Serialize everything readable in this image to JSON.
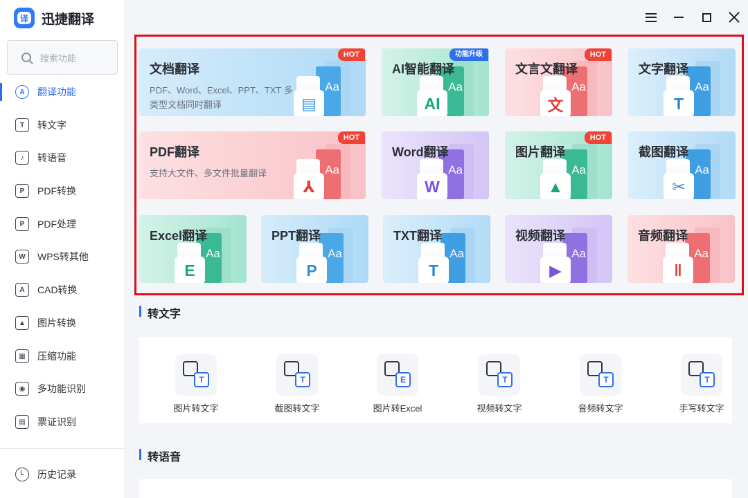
{
  "app": {
    "title": "迅捷翻译",
    "logo_glyph": "译"
  },
  "search": {
    "placeholder": "搜索功能"
  },
  "sidebar": {
    "items": [
      {
        "label": "翻译功能",
        "icon": "translate-icon",
        "glyph": "A"
      },
      {
        "label": "转文字",
        "icon": "text-convert-icon",
        "glyph": "T"
      },
      {
        "label": "转语音",
        "icon": "voice-icon",
        "glyph": "♪"
      },
      {
        "label": "PDF转换",
        "icon": "pdf-convert-icon",
        "glyph": "P"
      },
      {
        "label": "PDF处理",
        "icon": "pdf-process-icon",
        "glyph": "P"
      },
      {
        "label": "WPS转其他",
        "icon": "wps-icon",
        "glyph": "W"
      },
      {
        "label": "CAD转换",
        "icon": "cad-icon",
        "glyph": "A"
      },
      {
        "label": "图片转换",
        "icon": "image-convert-icon",
        "glyph": "▲"
      },
      {
        "label": "压缩功能",
        "icon": "compress-icon",
        "glyph": "▦"
      },
      {
        "label": "多功能识别",
        "icon": "eye-icon",
        "glyph": "◉"
      },
      {
        "label": "票证识别",
        "icon": "ticket-icon",
        "glyph": "▤"
      },
      {
        "label": "历史记录",
        "icon": "history-icon"
      }
    ]
  },
  "translate_cards": [
    {
      "title": "文档翻译",
      "desc": "PDF、Word、Excel、PPT、TXT 多类型文档同时翻译",
      "badge": "HOT",
      "theme": "c-blue",
      "glyph": "▤",
      "aa": "Aa"
    },
    {
      "title": "AI智能翻译",
      "desc": "",
      "badge": "功能升级",
      "theme": "c-green",
      "glyph": "AI",
      "aa": "Aa"
    },
    {
      "title": "文言文翻译",
      "desc": "",
      "badge": "HOT",
      "theme": "c-red",
      "glyph": "文",
      "aa": "Aa"
    },
    {
      "title": "文字翻译",
      "desc": "",
      "badge": "",
      "theme": "c-blue2",
      "glyph": "T",
      "aa": "Aa"
    },
    {
      "title": "PDF翻译",
      "desc": "支持大文件、多文件批量翻译",
      "badge": "HOT",
      "theme": "c-red",
      "glyph": "⅄",
      "aa": "Aa"
    },
    {
      "title": "Word翻译",
      "desc": "",
      "badge": "",
      "theme": "c-purple",
      "glyph": "W",
      "aa": "Aa"
    },
    {
      "title": "图片翻译",
      "desc": "",
      "badge": "HOT",
      "theme": "c-green",
      "glyph": "▲",
      "aa": "Aa"
    },
    {
      "title": "截图翻译",
      "desc": "",
      "badge": "",
      "theme": "c-blue2",
      "glyph": "✂",
      "aa": "Aa"
    },
    {
      "title": "Excel翻译",
      "desc": "",
      "badge": "",
      "theme": "c-green",
      "glyph": "E",
      "aa": "Aa"
    },
    {
      "title": "PPT翻译",
      "desc": "",
      "badge": "",
      "theme": "c-blue",
      "glyph": "P",
      "aa": "Aa"
    },
    {
      "title": "TXT翻译",
      "desc": "",
      "badge": "",
      "theme": "c-blue2",
      "glyph": "T",
      "aa": "Aa"
    },
    {
      "title": "视频翻译",
      "desc": "",
      "badge": "",
      "theme": "c-purple",
      "glyph": "▶",
      "aa": "Aa"
    },
    {
      "title": "音频翻译",
      "desc": "",
      "badge": "",
      "theme": "c-red",
      "glyph": "‖",
      "aa": "Aa"
    }
  ],
  "sections": {
    "to_text": {
      "title": "转文字",
      "tools": [
        {
          "label": "图片转文字",
          "icon": "image-to-text-icon",
          "glyph": "T"
        },
        {
          "label": "截图转文字",
          "icon": "screenshot-to-text-icon",
          "glyph": "T"
        },
        {
          "label": "图片转Excel",
          "icon": "image-to-excel-icon",
          "glyph": "E"
        },
        {
          "label": "视频转文字",
          "icon": "video-to-text-icon",
          "glyph": "T"
        },
        {
          "label": "音频转文字",
          "icon": "audio-to-text-icon",
          "glyph": "T"
        },
        {
          "label": "手写转文字",
          "icon": "handwriting-to-text-icon",
          "glyph": "T"
        }
      ]
    },
    "to_voice": {
      "title": "转语音"
    }
  },
  "colors": {
    "accent": "#2f6fec",
    "hot": "#f24236",
    "highlight_frame": "#d9101a"
  }
}
